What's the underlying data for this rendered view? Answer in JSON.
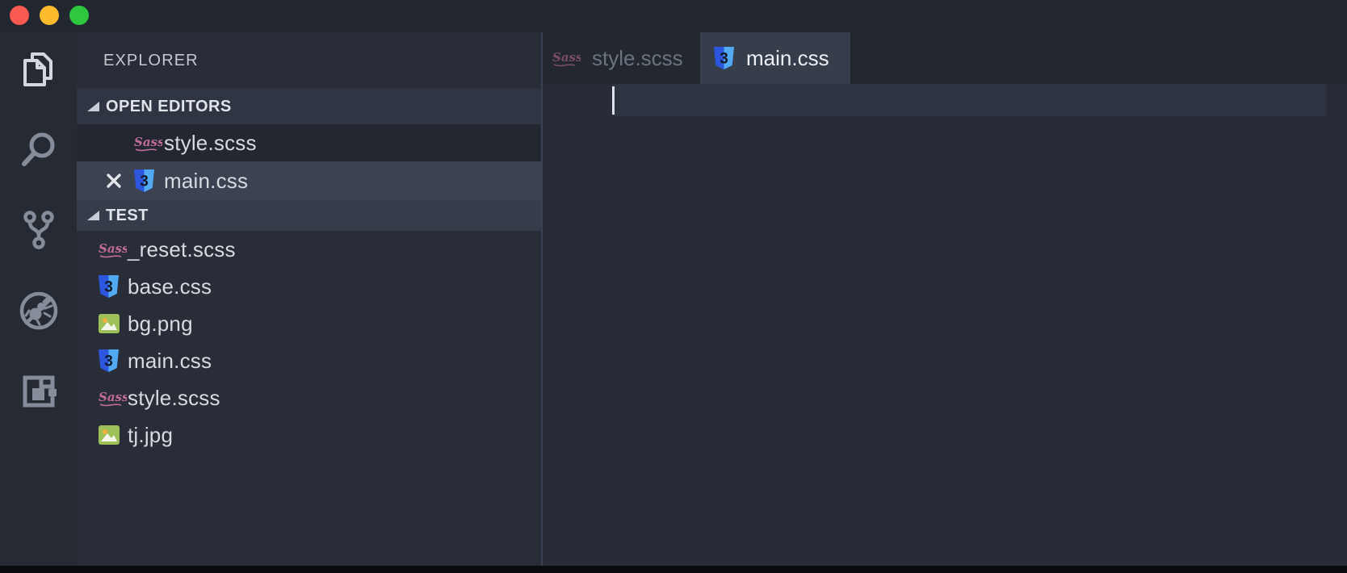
{
  "window": {
    "traffic_lights": [
      {
        "name": "close",
        "color": "#f95950"
      },
      {
        "name": "minimize",
        "color": "#fcbb2d"
      },
      {
        "name": "zoom",
        "color": "#2ec740"
      }
    ]
  },
  "activity_bar": {
    "items": [
      {
        "icon": "files-icon",
        "active": true
      },
      {
        "icon": "search-icon",
        "active": false
      },
      {
        "icon": "source-control-icon",
        "active": false
      },
      {
        "icon": "debug-icon",
        "active": false
      },
      {
        "icon": "extensions-icon",
        "active": false
      }
    ]
  },
  "sidebar": {
    "title": "EXPLORER",
    "sections": [
      {
        "label": "OPEN EDITORS"
      },
      {
        "label": "TEST"
      }
    ],
    "open_editors": [
      {
        "name": "style.scss",
        "icon": "sass-icon",
        "selected": false,
        "closable": false
      },
      {
        "name": "main.css",
        "icon": "css-icon",
        "selected": true,
        "closable": true
      }
    ],
    "files": [
      {
        "name": "_reset.scss",
        "icon": "sass-icon"
      },
      {
        "name": "base.css",
        "icon": "css-icon"
      },
      {
        "name": "bg.png",
        "icon": "image-icon"
      },
      {
        "name": "main.css",
        "icon": "css-icon"
      },
      {
        "name": "style.scss",
        "icon": "sass-icon"
      },
      {
        "name": "tj.jpg",
        "icon": "image-icon"
      }
    ]
  },
  "editor": {
    "tabs": [
      {
        "label": "style.scss",
        "icon": "sass-icon",
        "active": false
      },
      {
        "label": "main.css",
        "icon": "css-icon",
        "active": true
      }
    ],
    "content": "",
    "cursor_visible": true
  },
  "colors": {
    "css_blue_dark": "#2c56dd",
    "css_blue_light": "#51aaf1",
    "sass_pink": "#c06c9b",
    "image_green": "#9ec058",
    "selection_bg": "#3b4251",
    "active_tab_bg": "#363d4b",
    "editor_bg": "#272c36"
  }
}
